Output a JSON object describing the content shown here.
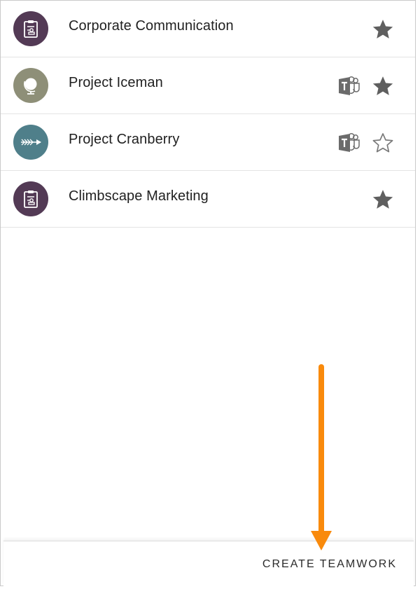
{
  "teams": [
    {
      "name": "Corporate Communication",
      "avatar_color": "#533a55",
      "avatar_icon": "clipboard-badge-icon",
      "has_ms_teams": false,
      "favorite": true
    },
    {
      "name": "Project Iceman",
      "avatar_color": "#8e8f78",
      "avatar_icon": "globe-icon",
      "has_ms_teams": true,
      "favorite": true
    },
    {
      "name": "Project Cranberry",
      "avatar_color": "#4f7f8a",
      "avatar_icon": "arrow-feather-icon",
      "has_ms_teams": true,
      "favorite": false
    },
    {
      "name": "Climbscape Marketing",
      "avatar_color": "#533a55",
      "avatar_icon": "clipboard-badge-icon",
      "has_ms_teams": false,
      "favorite": true
    }
  ],
  "footer": {
    "create_label": "CREATE TEAMWORK"
  },
  "colors": {
    "star_filled": "#5f5f5f",
    "star_outline": "#7a7a7a",
    "teams_icon": "#6b6b6b",
    "annotation_arrow": "#f98a0c"
  }
}
